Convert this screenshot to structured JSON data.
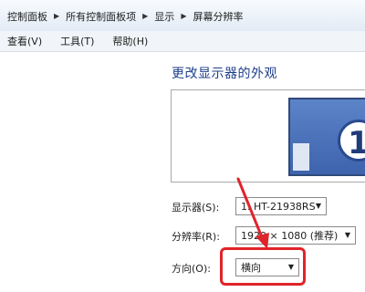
{
  "breadcrumb": [
    "控制面板",
    "所有控制面板项",
    "显示",
    "屏幕分辨率"
  ],
  "menu": [
    {
      "label": "查看(V)"
    },
    {
      "label": "工具(T)"
    },
    {
      "label": "帮助(H)"
    }
  ],
  "page": {
    "title": "更改显示器的外观"
  },
  "preview": {
    "monitor_number": "1"
  },
  "settings": {
    "display": {
      "label": "显示器(S):",
      "value": "1. HT-21938RS"
    },
    "resolution": {
      "label": "分辨率(R):",
      "value": "1920 × 1080 (推荐)"
    },
    "orientation": {
      "label": "方向(O):",
      "value": "横向"
    }
  },
  "colors": {
    "annotation": "#e0242a",
    "accent_title": "#1e3f8a"
  }
}
